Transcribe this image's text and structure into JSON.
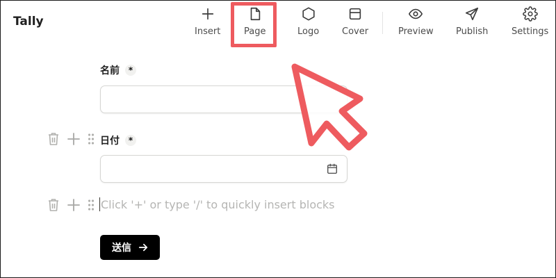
{
  "app": {
    "title": "Tally"
  },
  "toolbar": {
    "items": [
      {
        "label": "Insert",
        "icon": "plus-icon"
      },
      {
        "label": "Page",
        "icon": "page-icon"
      },
      {
        "label": "Logo",
        "icon": "hexagon-icon"
      },
      {
        "label": "Cover",
        "icon": "cover-icon"
      },
      {
        "label": "Preview",
        "icon": "eye-icon"
      },
      {
        "label": "Publish",
        "icon": "send-icon"
      },
      {
        "label": "Settings",
        "icon": "gear-icon"
      }
    ]
  },
  "form": {
    "fields": [
      {
        "label": "名前",
        "required_mark": "*",
        "type": "text",
        "value": ""
      },
      {
        "label": "日付",
        "required_mark": "*",
        "type": "date",
        "value": ""
      }
    ],
    "empty_block_placeholder": "Click '+' or type '/' to quickly insert blocks",
    "submit_label": "送信"
  },
  "annotation": {
    "highlight_color": "#ee5b5f",
    "arrow_color": "#ee5b5f"
  }
}
